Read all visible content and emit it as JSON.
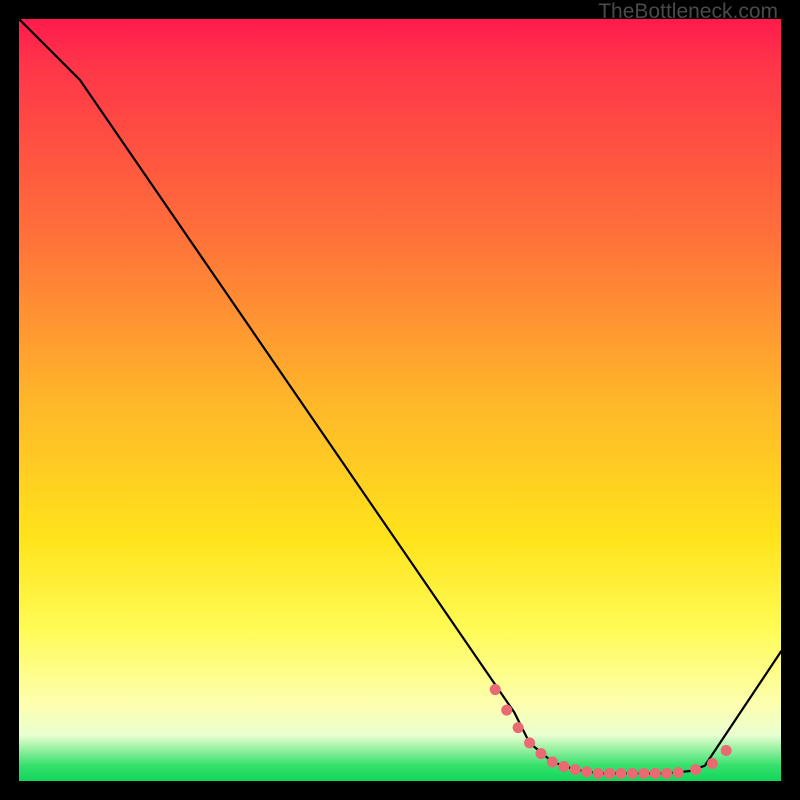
{
  "watermark": "TheBottleneck.com",
  "colors": {
    "line": "#000000",
    "marker_fill": "#e96a72",
    "marker_stroke": "#e96a72",
    "background": "#000000"
  },
  "chart_data": {
    "type": "line",
    "title": "",
    "xlabel": "",
    "ylabel": "",
    "xlim": [
      0,
      100
    ],
    "ylim": [
      0,
      100
    ],
    "series": [
      {
        "name": "curve",
        "x": [
          0,
          8,
          65,
          67,
          70,
          73,
          76,
          79,
          82,
          85,
          88,
          90,
          100
        ],
        "y": [
          100,
          92,
          9,
          5,
          2.5,
          1.5,
          1.0,
          1.0,
          1.0,
          1.0,
          1.3,
          2.0,
          17
        ]
      }
    ],
    "markers": {
      "name": "dots",
      "x": [
        62.5,
        64,
        65.5,
        67,
        68.5,
        70,
        71.5,
        73,
        74.5,
        76,
        77.5,
        79,
        80.5,
        82,
        83.5,
        85,
        86.5,
        88.8,
        91,
        92.8
      ],
      "y": [
        12,
        9.3,
        7,
        5,
        3.6,
        2.5,
        1.9,
        1.5,
        1.2,
        1.0,
        1.0,
        1.0,
        1.0,
        1.0,
        1.0,
        1.0,
        1.1,
        1.5,
        2.3,
        4.0
      ]
    }
  }
}
